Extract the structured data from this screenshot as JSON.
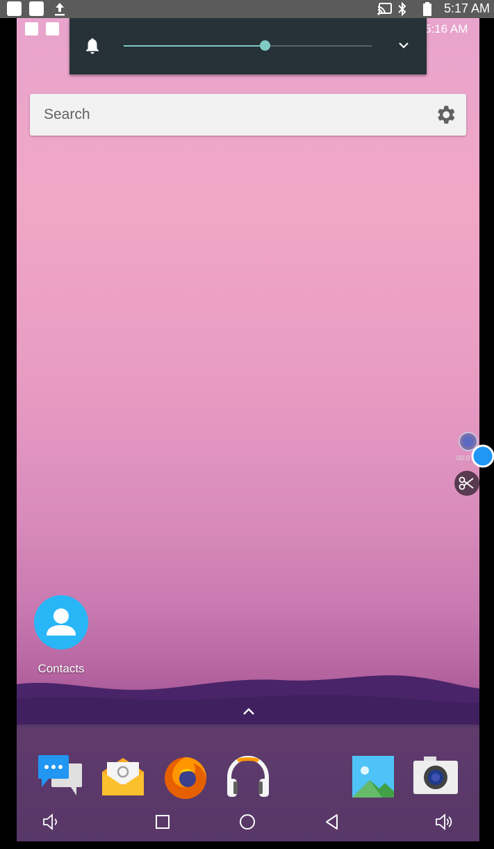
{
  "host_status_bar": {
    "time": "5:17 AM",
    "icons": [
      "notification-square-icon",
      "notification-square-icon",
      "upload-icon",
      "cast-icon",
      "bluetooth-icon",
      "battery-icon"
    ]
  },
  "device_status_bar": {
    "time": "5:16 AM"
  },
  "volume_panel": {
    "icon": "bell-icon",
    "level_fraction": 0.57,
    "expand_icon": "chevron-down-icon",
    "accent_color": "#7fcbc4"
  },
  "search": {
    "placeholder": "Search",
    "settings_icon": "gear-icon"
  },
  "home_apps": [
    {
      "label": "Contacts",
      "icon": "contacts-icon"
    }
  ],
  "app_drawer_icon": "chevron-up-icon",
  "dock": {
    "apps": [
      {
        "name": "Messaging",
        "icon": "messaging-icon"
      },
      {
        "name": "Email",
        "icon": "email-icon"
      },
      {
        "name": "Firefox",
        "icon": "firefox-icon"
      },
      {
        "name": "Music",
        "icon": "headphones-icon"
      },
      {
        "name": "Gallery",
        "icon": "gallery-icon"
      },
      {
        "name": "Camera",
        "icon": "camera-icon"
      }
    ]
  },
  "nav_bar": {
    "buttons": [
      "volume-down-icon",
      "recents-icon",
      "home-icon",
      "back-icon",
      "volume-up-icon"
    ]
  },
  "floating_widgets": {
    "recorder_time": "00:0",
    "icons": [
      "record-icon",
      "drag-handle-icon",
      "scissors-icon"
    ]
  },
  "colors": {
    "volume_panel_bg": "#263238",
    "dock_bg": "#5a3a68",
    "contacts_blue": "#29b6f6"
  }
}
